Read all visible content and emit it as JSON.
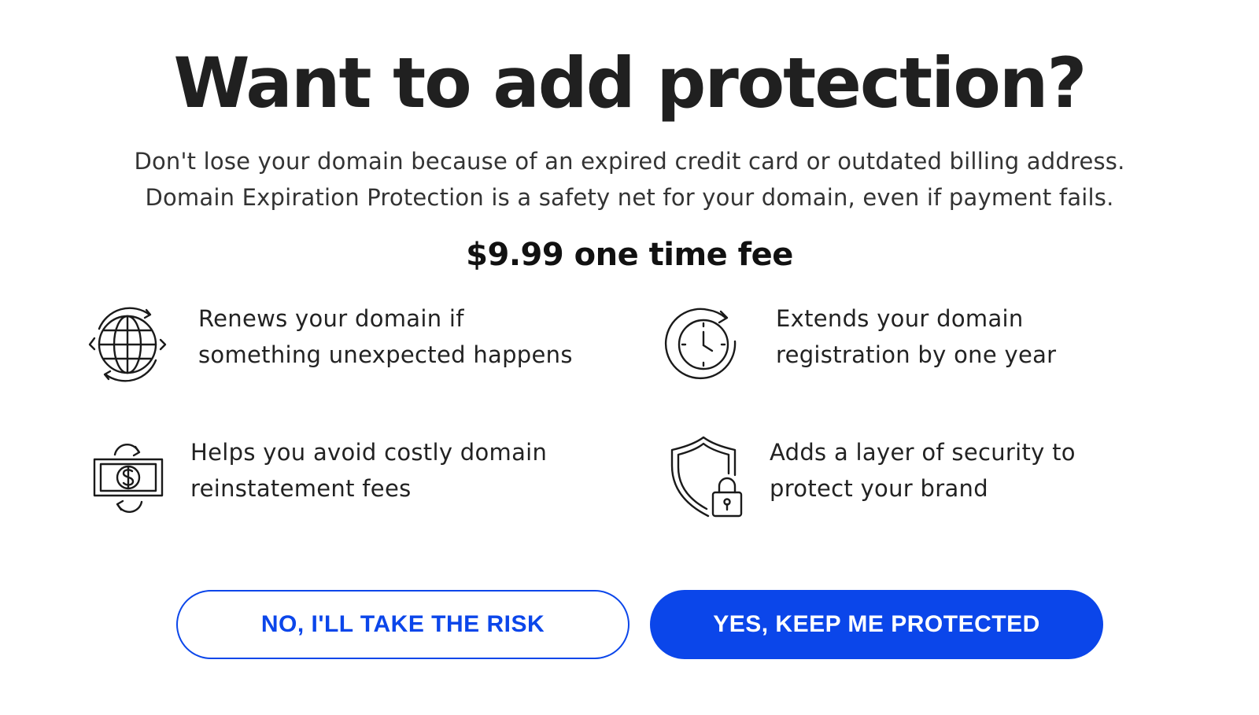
{
  "header": {
    "title": "Want to add protection?",
    "subtitle_line1": "Don't lose your domain because of an expired credit card or outdated billing address.",
    "subtitle_line2": "Domain Expiration Protection is a safety net for your domain, even if payment fails.",
    "price": "$9.99 one time fee"
  },
  "features": [
    {
      "icon": "globe-renew-icon",
      "line1": "Renews your domain if",
      "line2": "something unexpected happens"
    },
    {
      "icon": "clock-extend-icon",
      "line1": "Extends your domain",
      "line2": "registration by one year"
    },
    {
      "icon": "money-cycle-icon",
      "line1": "Helps you avoid costly domain",
      "line2": "reinstatement fees"
    },
    {
      "icon": "shield-lock-icon",
      "line1": "Adds a layer of security to",
      "line2": "protect your brand"
    }
  ],
  "actions": {
    "decline_label": "NO, I'LL TAKE THE RISK",
    "accept_label": "YES, KEEP ME PROTECTED"
  },
  "colors": {
    "accent": "#0b46ea",
    "title": "#202020"
  }
}
